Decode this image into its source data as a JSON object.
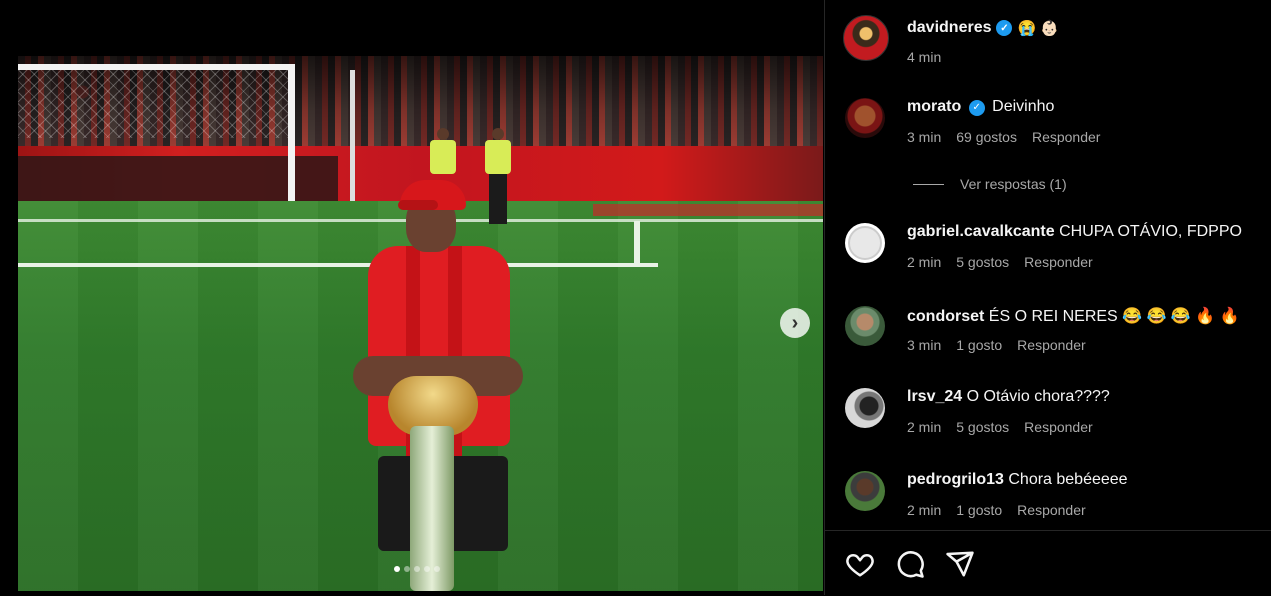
{
  "post": {
    "author": {
      "username": "davidneres",
      "emojis": "😭 👶🏻",
      "time": "4 min"
    },
    "carousel": {
      "slides": 5,
      "active_index": 0,
      "next_icon": "chevron-right-icon"
    }
  },
  "comments": [
    {
      "username": "morato",
      "verified": true,
      "text": "Deivinho",
      "time": "3 min",
      "likes": "69 gostos",
      "reply": "Responder",
      "view_replies": "Ver respostas (1)"
    },
    {
      "username": "gabriel.cavalkcante",
      "verified": false,
      "text": "CHUPA OTÁVIO, FDPPO",
      "time": "2 min",
      "likes": "5 gostos",
      "reply": "Responder"
    },
    {
      "username": "condorset",
      "verified": false,
      "text": "ÉS O REI NERES 😂 😂 😂 🔥 🔥",
      "time": "3 min",
      "likes": "1 gosto",
      "reply": "Responder"
    },
    {
      "username": "lrsv_24",
      "verified": false,
      "text": "O Otávio chora????",
      "time": "2 min",
      "likes": "5 gostos",
      "reply": "Responder"
    },
    {
      "username": "pedrogrilo13",
      "verified": false,
      "text": "Chora bebéeeee",
      "time": "2 min",
      "likes": "1 gosto",
      "reply": "Responder"
    }
  ],
  "actions": [
    "heart-icon",
    "comment-icon",
    "share-icon"
  ],
  "colors": {
    "background": "#000000",
    "verified": "#1d9bf0",
    "secondary_text": "#a8a8a8",
    "divider": "#262626"
  }
}
